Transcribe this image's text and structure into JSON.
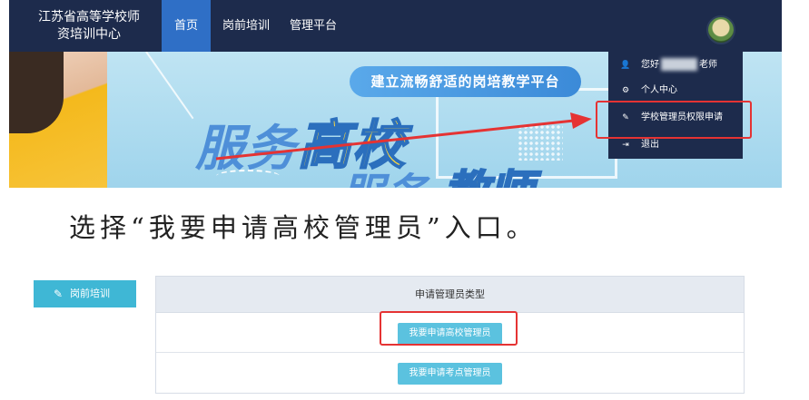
{
  "header": {
    "logo_text": "江苏省高等学校师资培训中心",
    "nav": [
      {
        "label": "首页",
        "active": true
      },
      {
        "label": "岗前培训",
        "active": false
      },
      {
        "label": "管理平台",
        "active": false
      }
    ]
  },
  "banner": {
    "slogan": "建立流畅舒适的岗培教学平台",
    "headline_part1": "服务",
    "headline_part2": "高校",
    "headline_part3": "服务",
    "headline_part4": "教师"
  },
  "user_menu": {
    "items": [
      {
        "icon": "user-icon",
        "glyph": "👤",
        "label_prefix": "您好",
        "label_suffix": "老师"
      },
      {
        "icon": "gear-icon",
        "glyph": "⚙",
        "label": "个人中心"
      },
      {
        "icon": "edit-icon",
        "glyph": "✎",
        "label": "学校管理员权限申请"
      },
      {
        "icon": "logout-icon",
        "glyph": "⇥",
        "label": "退出"
      }
    ]
  },
  "instruction": "选择“我要申请高校管理员”入口。",
  "apply_panel": {
    "side_button": {
      "icon": "pencil-icon",
      "label": "岗前培训"
    },
    "table_header": "申请管理员类型",
    "buttons": [
      {
        "label": "我要申请高校管理员"
      },
      {
        "label": "我要申请考点管理员"
      }
    ]
  },
  "colors": {
    "nav_bg": "#1d2b4c",
    "nav_active": "#2f6fc6",
    "highlight_red": "#e53333",
    "button_cyan": "#5bc2df"
  }
}
